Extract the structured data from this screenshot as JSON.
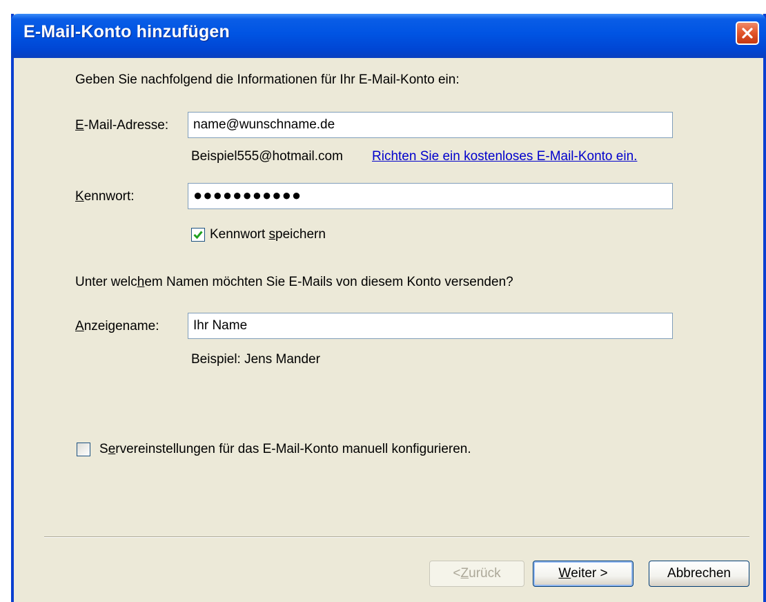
{
  "window": {
    "title": "E-Mail-Konto hinzufügen"
  },
  "intro": "Geben Sie nachfolgend die Informationen für Ihr E-Mail-Konto ein:",
  "email": {
    "label_access_key": "E",
    "label_rest": "-Mail-Adresse:",
    "value": "name@wunschname.de",
    "example": "Beispiel555@hotmail.com",
    "signup_link": "Richten Sie ein kostenloses E-Mail-Konto ein."
  },
  "password": {
    "label_access_key": "K",
    "label_rest": "ennwort:",
    "value_masked": "●●●●●●●●●●●",
    "remember_before": "Kennwort ",
    "remember_access_key": "s",
    "remember_after": "peichern",
    "remember_checked": true
  },
  "sender_question": {
    "before": "Unter welc",
    "access_key": "h",
    "after": "em Namen möchten Sie E-Mails von diesem Konto versenden?"
  },
  "display_name": {
    "label_access_key": "A",
    "label_rest": "nzeigename:",
    "value": "Ihr Name",
    "example": "Beispiel: Jens Mander"
  },
  "manual_config": {
    "before": "S",
    "access_key": "e",
    "after": "rvereinstellungen für das E-Mail-Konto manuell konfigurieren.",
    "checked": false
  },
  "buttons": {
    "back_before": "< ",
    "back_access_key": "Z",
    "back_after": "urück",
    "back_enabled": false,
    "next_access_key": "W",
    "next_after": "eiter >",
    "cancel": "Abbrechen"
  },
  "colors": {
    "titlebar": "#0054e3",
    "dialog_bg": "#ece9d8",
    "link": "#0000cc",
    "close_button": "#e2542a",
    "check_mark": "#21a121"
  }
}
